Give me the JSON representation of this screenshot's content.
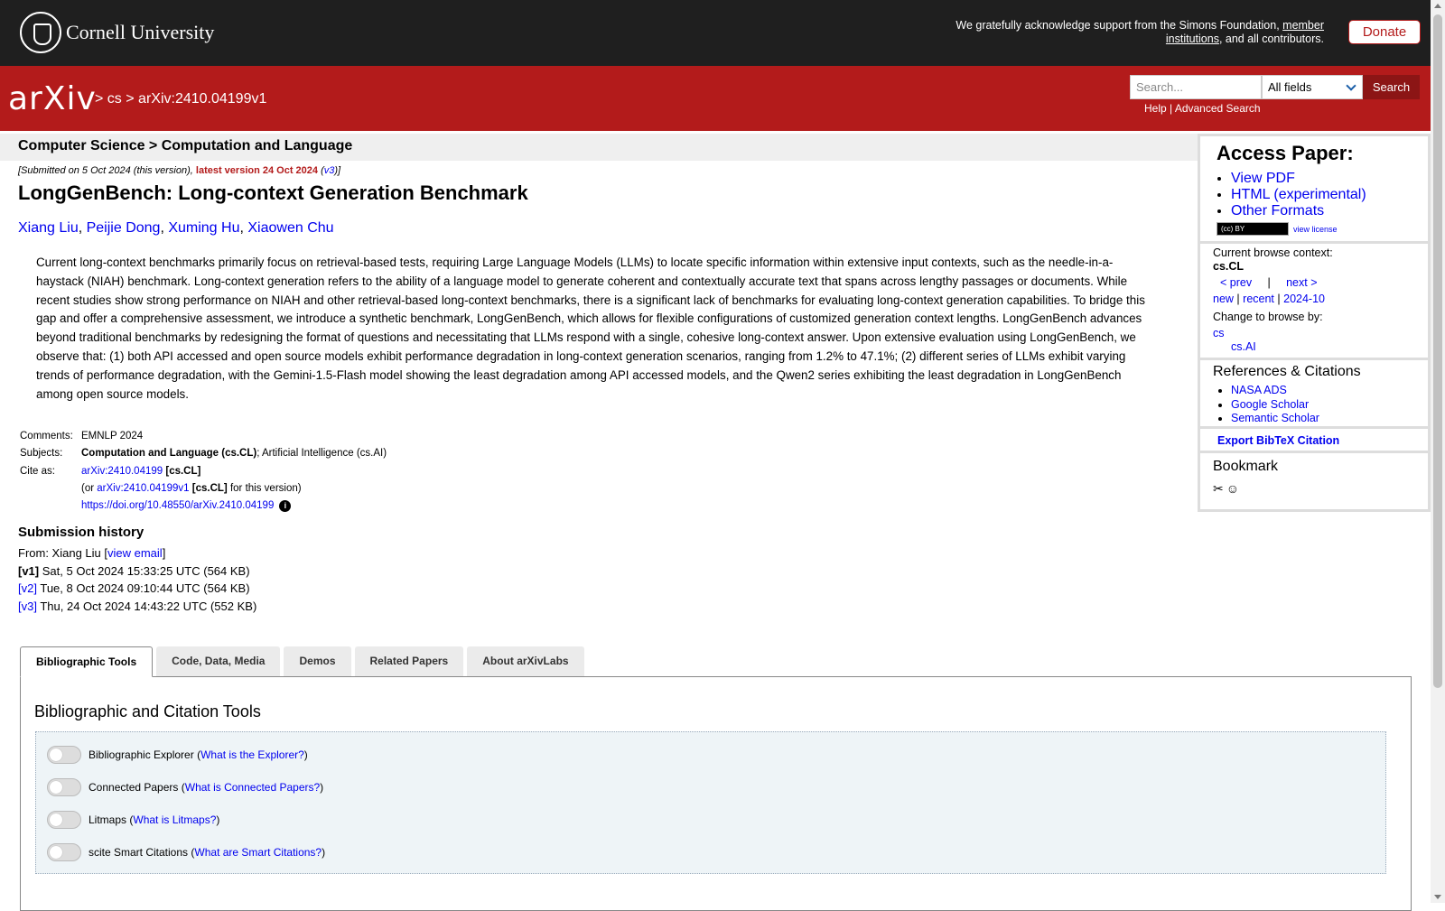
{
  "header": {
    "university": "Cornell University",
    "ack_text_1": "We gratefully acknowledge support from the Simons Foundation,",
    "ack_link": "member institutions",
    "ack_text_2": ", and all contributors.",
    "donate_label": "Donate"
  },
  "navbar": {
    "logo_text": "arXiv",
    "crumb_sep": ">",
    "crumb_cs": "cs",
    "crumb_id": "arXiv:2410.04199v1",
    "search_placeholder": "Search...",
    "search_field_selected": "All fields",
    "search_button": "Search",
    "help": "Help",
    "pipe": "|",
    "advanced": "Advanced Search"
  },
  "paper": {
    "subject_header": "Computer Science > Computation and Language",
    "submitted_pre": "[Submitted on 5 Oct 2024 (this version),",
    "submitted_latest": "latest version 24 Oct 2024",
    "submitted_v3": "v3",
    "title": "LongGenBench: Long-context Generation Benchmark",
    "authors": [
      "Xiang Liu",
      "Peijie Dong",
      "Xuming Hu",
      "Xiaowen Chu"
    ],
    "abstract": "Current long-context benchmarks primarily focus on retrieval-based tests, requiring Large Language Models (LLMs) to locate specific information within extensive input contexts, such as the needle-in-a-haystack (NIAH) benchmark. Long-context generation refers to the ability of a language model to generate coherent and contextually accurate text that spans across lengthy passages or documents. While recent studies show strong performance on NIAH and other retrieval-based long-context benchmarks, there is a significant lack of benchmarks for evaluating long-context generation capabilities. To bridge this gap and offer a comprehensive assessment, we introduce a synthetic benchmark, LongGenBench, which allows for flexible configurations of customized generation context lengths. LongGenBench advances beyond traditional benchmarks by redesigning the format of questions and necessitating that LLMs respond with a single, cohesive long-context answer. Upon extensive evaluation using LongGenBench, we observe that: (1) both API accessed and open source models exhibit performance degradation in long-context generation scenarios, ranging from 1.2% to 47.1%; (2) different series of LLMs exhibit varying trends of performance degradation, with the Gemini-1.5-Flash model showing the least degradation among API accessed models, and the Qwen2 series exhibiting the least degradation in LongGenBench among open source models."
  },
  "meta": {
    "comments_label": "Comments:",
    "comments": "EMNLP 2024",
    "subjects_label": "Subjects:",
    "subjects_bold": "Computation and Language (cs.CL)",
    "subjects_rest": "; Artificial Intelligence (cs.AI)",
    "cite_label": "Cite as:",
    "cite_id": "arXiv:2410.04199",
    "cite_tag": "[cs.CL]",
    "cite_or": "(or",
    "cite_v1": "arXiv:2410.04199v1",
    "cite_v1_tag": "[cs.CL]",
    "cite_v1_post": "for this version)",
    "doi": "https://doi.org/10.48550/arXiv.2410.04199",
    "info_glyph": "i"
  },
  "history": {
    "title": "Submission history",
    "from_pre": "From: Xiang Liu [",
    "view_email": "view email",
    "from_post": "]",
    "versions": [
      {
        "tag": "[v1]",
        "text": "Sat, 5 Oct 2024 15:33:25 UTC (564 KB)"
      },
      {
        "tag": "[v2]",
        "text": "Tue, 8 Oct 2024 09:10:44 UTC (564 KB)"
      },
      {
        "tag": "[v3]",
        "text": "Thu, 24 Oct 2024 14:43:22 UTC (552 KB)"
      }
    ]
  },
  "tabs": [
    "Bibliographic Tools",
    "Code, Data, Media",
    "Demos",
    "Related Papers",
    "About arXivLabs"
  ],
  "tools": {
    "panel_title": "Bibliographic and Citation Tools",
    "items": [
      {
        "label": "Bibliographic Explorer",
        "link": "What is the Explorer?"
      },
      {
        "label": "Connected Papers",
        "link": "What is Connected Papers?"
      },
      {
        "label": "Litmaps",
        "link": "What is Litmaps?"
      },
      {
        "label": "scite Smart Citations",
        "link": "What are Smart Citations?"
      }
    ]
  },
  "sidebar": {
    "access_title": "Access Paper:",
    "access_links": [
      "View PDF",
      "HTML (experimental)",
      "Other Formats"
    ],
    "cc_badge": "(cc) BY",
    "view_license": "view license",
    "browse_context_label": "Current browse context:",
    "browse_context": "cs.CL",
    "prev": "< prev",
    "sep": "|",
    "next": "next >",
    "new": "new",
    "recent": "recent",
    "month": "2024-10",
    "change_label": "Change to browse by:",
    "browse_cs": "cs",
    "browse_csai": "cs.AI",
    "refs_title": "References & Citations",
    "refs_links": [
      "NASA ADS",
      "Google Scholar",
      "Semantic Scholar"
    ],
    "bibtex": "Export BibTeX Citation",
    "bookmark_title": "Bookmark"
  },
  "colors": {
    "arxiv_red": "#b31b1b",
    "link_blue": "#0000ee",
    "topbar": "#1f1f1f"
  }
}
